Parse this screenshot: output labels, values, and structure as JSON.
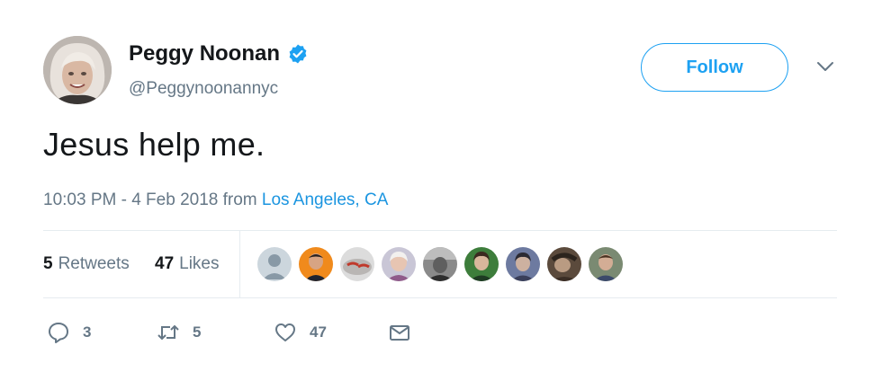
{
  "author": {
    "name": "Peggy Noonan",
    "handle": "@Peggynoonannyc",
    "verified": true
  },
  "follow_label": "Follow",
  "tweet": {
    "text": "Jesus help me.",
    "timestamp": "10:03 PM - 4 Feb 2018",
    "from_label": "from",
    "location": "Los Angeles, CA"
  },
  "stats": {
    "retweets_count": "5",
    "retweets_label": "Retweets",
    "likes_count": "47",
    "likes_label": "Likes"
  },
  "actions": {
    "reply_count": "3",
    "retweet_count": "5",
    "like_count": "47"
  },
  "colors": {
    "brand": "#1da1f2",
    "link": "#1b95e0",
    "muted": "#657786",
    "text": "#14171a"
  }
}
